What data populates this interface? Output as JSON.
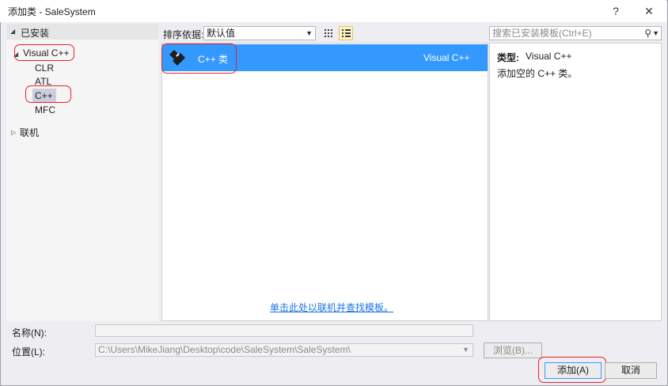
{
  "window": {
    "title": "添加类 - SaleSystem",
    "help_label": "?",
    "close_label": "✕"
  },
  "tree": {
    "installed_label": "已安装",
    "items": [
      {
        "label": "Visual C++"
      },
      {
        "label": "CLR"
      },
      {
        "label": "ATL"
      },
      {
        "label": "C++"
      },
      {
        "label": "MFC"
      }
    ],
    "online_label": "联机"
  },
  "sortbar": {
    "label": "排序依据:",
    "selected": "默认值"
  },
  "search": {
    "placeholder": "搜索已安装模板(Ctrl+E)"
  },
  "templates": [
    {
      "name": "C++ 类",
      "category": "Visual C++"
    }
  ],
  "online_link": "单击此处以联机并查找模板。",
  "details": {
    "type_label": "类型:",
    "type_value": "Visual C++",
    "description": "添加空的 C++ 类。"
  },
  "form": {
    "name_label": "名称(N):",
    "name_value": "",
    "location_label": "位置(L):",
    "location_value": "C:\\Users\\MikeJiang\\Desktop\\code\\SaleSystem\\SaleSystem\\",
    "browse_label": "浏览(B)...",
    "add_label": "添加(A)",
    "cancel_label": "取消"
  },
  "colors": {
    "selection": "#3399ff",
    "highlight": "#e8202a",
    "link": "#1a73e8"
  }
}
